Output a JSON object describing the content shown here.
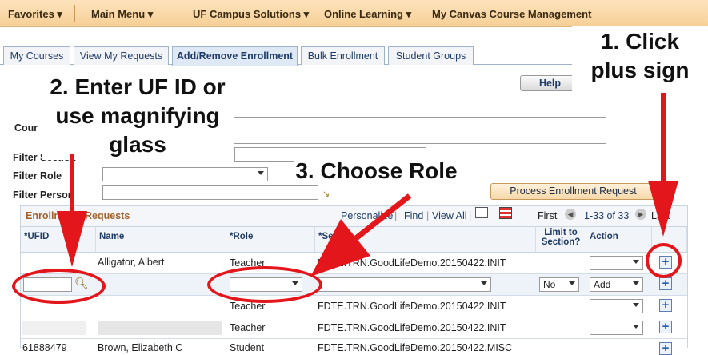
{
  "topnav": {
    "favorites": "Favorites ▾",
    "main_menu": "Main Menu ▾",
    "campus": "UF Campus Solutions ▾",
    "online": "Online Learning ▾",
    "canvas": "My Canvas Course Management"
  },
  "tabs": [
    {
      "label": "My Courses"
    },
    {
      "label": "View My Requests"
    },
    {
      "label": "Add/Remove Enrollment"
    },
    {
      "label": "Bulk Enrollment"
    },
    {
      "label": "Student Groups"
    }
  ],
  "help_button": "Help",
  "labels": {
    "course": "Cour",
    "filter_section": "Filter Section",
    "filter_role": "Filter Role",
    "filter_person": "Filter Person"
  },
  "process_button": "Process Enrollment Request",
  "grid": {
    "title_a": "Enrollm",
    "title_b": "Requests",
    "personalize": "Personalize",
    "find": "Find",
    "view_all": "View All",
    "first": "First",
    "range": "1-33 of 33",
    "last": "Last",
    "columns": {
      "ufid": "*UFID",
      "name": "Name",
      "role": "*Role",
      "section": "*Secti",
      "limit": "Limit to Section?",
      "action": "Action"
    },
    "rows": [
      {
        "name": "Alligator, Albert",
        "role": "Teacher",
        "section": "FDTE.TRN.GoodLifeDemo.20150422.INIT"
      },
      {
        "limit": "No",
        "action": "Add"
      },
      {
        "role": "Teacher",
        "section": "FDTE.TRN.GoodLifeDemo.20150422.INIT"
      },
      {
        "role": "Teacher",
        "section": "FDTE.TRN.GoodLifeDemo.20150422.INIT"
      },
      {
        "ufid": "61888479",
        "name": "Brown, Elizabeth C",
        "role": "Student",
        "section": "FDTE.TRN.GoodLifeDemo.20150422.MISC"
      }
    ]
  },
  "annotations": {
    "step1_a": "1. Click",
    "step1_b": "plus sign",
    "step2_a": "2. Enter UF ID or",
    "step2_b": "use magnifying",
    "step2_c": "glass",
    "step3": "3. Choose Role"
  },
  "colors": {
    "arrow": "#e3171b",
    "nav": "#f6cf96",
    "link": "#1f3c66"
  }
}
